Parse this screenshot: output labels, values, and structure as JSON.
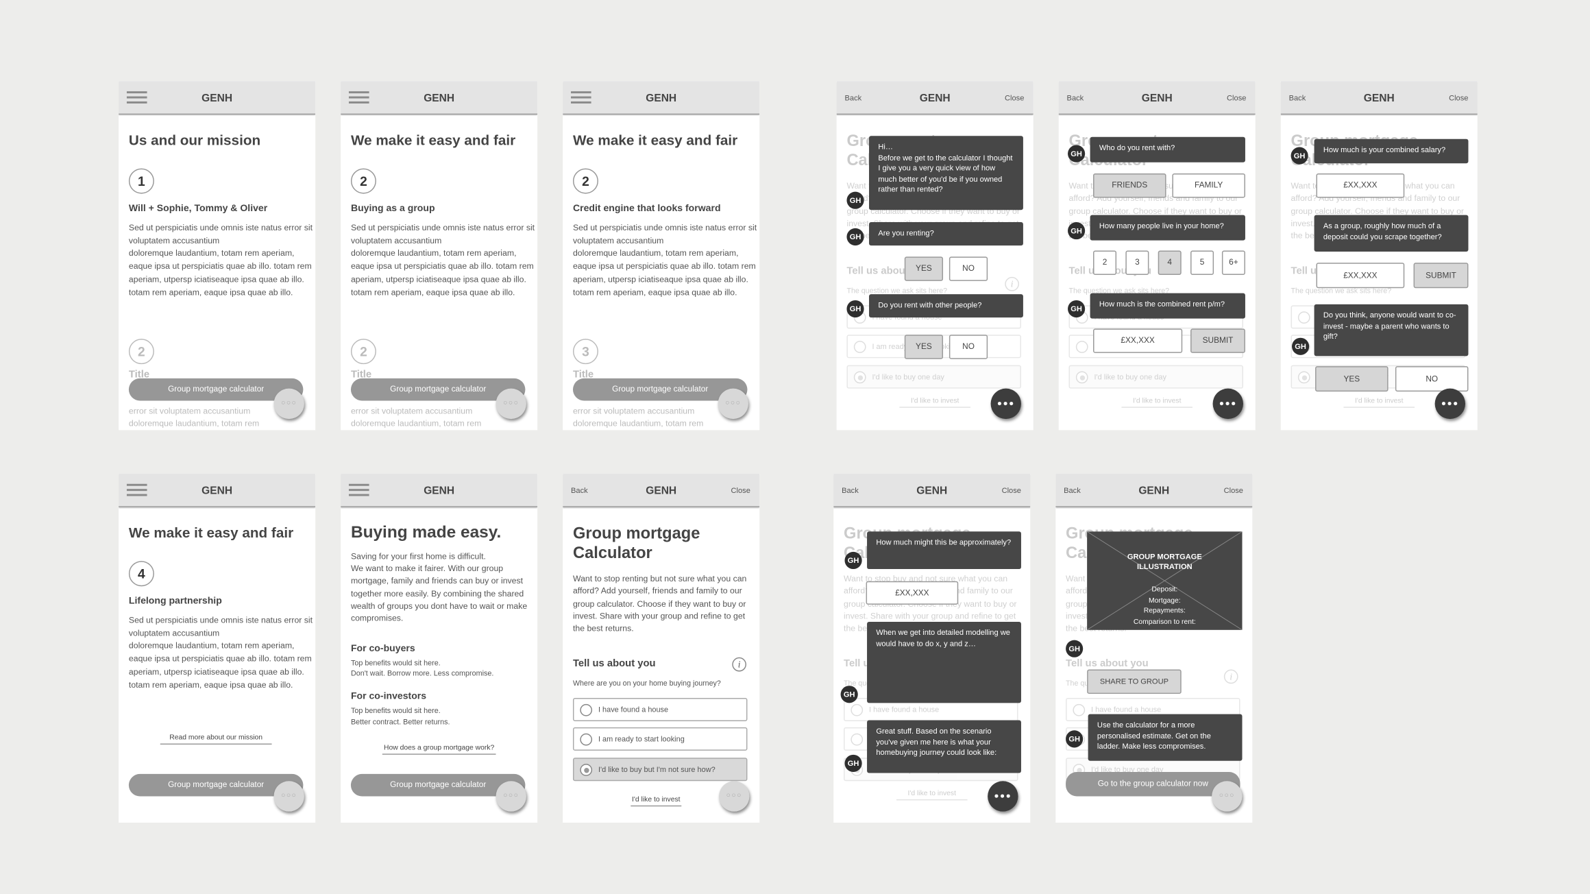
{
  "brand": "GENH",
  "nav": {
    "back": "Back",
    "close": "Close"
  },
  "fab": {
    "dots": "●●●",
    "dots_light": "○○○"
  },
  "calculator_cta": "Group mortgage calculator",
  "lorem": "Sed ut perspiciatis unde omnis iste natus error sit voluptatem accusantium\n doloremque laudantium, totam rem aperiam, eaque ipsa  ut perspiciatis quae ab illo. totam rem aperiam,  utpersp iciatiseaque ipsa quae ab illo. totam rem aperiam, eaque ipsa quae ab illo.",
  "faded_title": "Title",
  "faded_lorem": "error sit voluptatem accusantium\n doloremque laudantium, totam rem",
  "screens": {
    "mission1": {
      "title": "Us and our mission",
      "step": "1",
      "subtitle": "Will + Sophie, Tommy & Oliver",
      "next_step": "2"
    },
    "mission2": {
      "title": "We make it easy and fair",
      "step": "2",
      "subtitle": "Buying as a group",
      "next_step": "2"
    },
    "mission3": {
      "title": "We make it easy and fair",
      "step": "2",
      "subtitle": "Credit engine that looks forward",
      "next_step": "3"
    },
    "mission4": {
      "title": "We make it easy and fair",
      "step": "4",
      "subtitle": "Lifelong partnership",
      "link": "Read more about our mission"
    },
    "buying": {
      "title": "Buying made easy.",
      "intro": "Saving for your first home is difficult.\nWe want to make it fairer. With our group mortgage, family and friends can buy or invest together more easily. By combining the shared wealth of groups you dont have to wait or make compromises.",
      "cobuyers_heading": "For co-buyers",
      "cobuyers_text": "Top benefits would sit here.\nDon't wait. Borrow more. Less compromise.",
      "coinvestors_heading": "For co-investors",
      "coinvestors_text": "Top benefits would sit here.\nBetter contract. Better returns.",
      "link": "How does a group mortgage work?"
    },
    "calculator": {
      "title": "Group mortgage\nCalculator",
      "intro": "Want to stop renting but not sure what you can afford? Add yourself, friends and family to our group calculator. Choose if they want to buy or invest. Share with your group and refine to get the best returns.",
      "section": "Tell us about you",
      "question": "Where are you on your home buying journey?",
      "options": [
        "I have found a house",
        "I am ready to start looking",
        "I'd like to buy but I'm not sure how?"
      ],
      "selected_option": 2,
      "link": "I'd like to invest"
    },
    "faded_calc": {
      "title": "Group mortgage\nCalculator",
      "intro": "Want to stop buy and not sure what you can afford? Add yourself, friends and family to our group calculator. Choose if they want to buy or invest. Share with your group and refine to get the best returns.",
      "section": "Tell us about you",
      "question": "The question we ask sits here?",
      "options": [
        "I have found a house",
        "I am ready to start looking",
        "I'd like to buy one day"
      ],
      "link": "I'd like to invest"
    },
    "chat1": {
      "avatar": "GH",
      "msg1": "Hi…\nBefore we get to the calculator I thought I give you a very quick view of how much better of you'd be if you owned rather than rented?",
      "msg2": "Are you renting?",
      "msg3": "Do you rent with other people?",
      "yes": "YES",
      "no": "NO"
    },
    "chat2": {
      "msg1": "Who do you rent with?",
      "friends": "FRIENDS",
      "family": "FAMILY",
      "msg2": "How many people live in your home?",
      "counts": [
        "2",
        "3",
        "4",
        "5",
        "6+"
      ],
      "selected_count": "4",
      "msg3": "How much is the combined rent p/m?",
      "amount_placeholder": "£XX,XXX",
      "submit": "SUBMIT"
    },
    "chat3": {
      "msg1": "How much is your combined salary?",
      "amount_placeholder": "£XX,XXX",
      "msg2": "As a group, roughly how much of a deposit could you scrape together?",
      "submit": "SUBMIT",
      "msg3": "Do you think, anyone would want to co-invest - maybe a parent who wants to gift?",
      "yes": "YES",
      "no": "NO"
    },
    "chat4": {
      "msg1": "How much might this be approximately?",
      "amount_placeholder": "£XX,XXX",
      "msg2": "When we get into detailed modelling we would have to do x, y and z…",
      "msg3": "Great stuff. Based on the scenario you've given me here is what your homebuying journey could look like:"
    },
    "result": {
      "illustration_title": "GROUP MORTGAGE\nILLUSTRATION",
      "illustration_lines": "Deposit:\nMortgage:\nRepayments:\nComparison to rent:",
      "share": "SHARE TO GROUP",
      "msg": "Use the calculator for a more personalised estimate. Get on the ladder. Make less compromises.",
      "cta": "Go to the group calculator now"
    }
  },
  "colors": {
    "background": "#ededeb",
    "header": "#e4e4e4",
    "bubble": "#474747",
    "pill": "#979797",
    "avatar": "#2e2e2e"
  }
}
